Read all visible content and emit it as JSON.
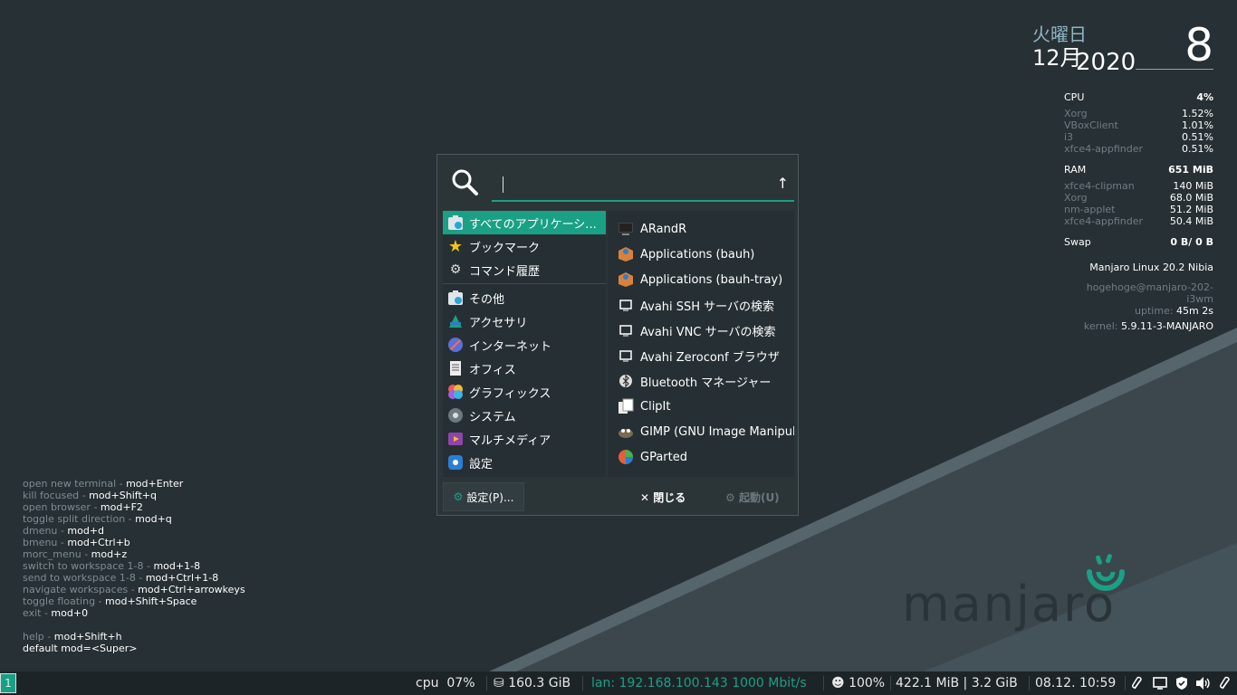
{
  "conky_date": {
    "weekday": "火曜日",
    "month": "12月",
    "year": "2020",
    "day": "8"
  },
  "conky_stats": {
    "cpu": {
      "label": "CPU",
      "value": "4%",
      "procs": [
        {
          "name": "Xorg",
          "value": "1.52%"
        },
        {
          "name": "VBoxClient",
          "value": "1.01%"
        },
        {
          "name": "i3",
          "value": "0.51%"
        },
        {
          "name": "xfce4-appfinder",
          "value": "0.51%"
        }
      ]
    },
    "ram": {
      "label": "RAM",
      "value": "651 MiB",
      "procs": [
        {
          "name": "xfce4-clipman",
          "value": "140 MiB"
        },
        {
          "name": "Xorg",
          "value": "68.0 MiB"
        },
        {
          "name": "nm-applet",
          "value": "51.2 MiB"
        },
        {
          "name": "xfce4-appfinder",
          "value": "50.4 MiB"
        }
      ]
    },
    "swap": {
      "label": "Swap",
      "value": "0 B/ 0 B"
    },
    "os": "Manjaro Linux 20.2 Nibia",
    "host": "hogehoge@manjaro-202-i3wm",
    "uptime_label": "uptime:",
    "uptime_value": "45m 2s",
    "kernel_label": "kernel:",
    "kernel_value": "5.9.11-3-MANJARO"
  },
  "help": [
    {
      "k": "open new terminal - ",
      "v": "mod+Enter"
    },
    {
      "k": "kill focused - ",
      "v": "mod+Shift+q"
    },
    {
      "k": "open browser - ",
      "v": "mod+F2"
    },
    {
      "k": "toggle split direction - ",
      "v": "mod+q"
    },
    {
      "k": "dmenu - ",
      "v": "mod+d"
    },
    {
      "k": "bmenu - ",
      "v": "mod+Ctrl+b"
    },
    {
      "k": "morc_menu - ",
      "v": "mod+z"
    },
    {
      "k": "switch to workspace 1-8 - ",
      "v": "mod+1-8"
    },
    {
      "k": "send to workspace 1-8 - ",
      "v": "mod+Ctrl+1-8"
    },
    {
      "k": "navigate workspaces - ",
      "v": "mod+Ctrl+arrowkeys"
    },
    {
      "k": "toggle floating - ",
      "v": "mod+Shift+Space"
    },
    {
      "k": "exit - ",
      "v": "mod+0"
    },
    {
      "k": "",
      "v": ""
    },
    {
      "k": "help - ",
      "v": "mod+Shift+h"
    },
    {
      "k": "",
      "v": "default mod=<Super>"
    }
  ],
  "logo_text": "manjaro",
  "finder": {
    "search_value": "",
    "categories": [
      {
        "label": "すべてのアプリケーシ...",
        "icon": "all-apps-icon",
        "selected": true
      },
      {
        "label": "ブックマーク",
        "icon": "star-icon"
      },
      {
        "label": "コマンド履歴",
        "icon": "history-icon"
      },
      {
        "label": "その他",
        "icon": "other-icon"
      },
      {
        "label": "アクセサリ",
        "icon": "accessories-icon"
      },
      {
        "label": "インターネット",
        "icon": "internet-icon"
      },
      {
        "label": "オフィス",
        "icon": "office-icon"
      },
      {
        "label": "グラフィックス",
        "icon": "graphics-icon"
      },
      {
        "label": "システム",
        "icon": "system-icon"
      },
      {
        "label": "マルチメディア",
        "icon": "multimedia-icon"
      },
      {
        "label": "設定",
        "icon": "settings-icon"
      }
    ],
    "apps": [
      {
        "label": "ARandR",
        "icon": "monitor-icon"
      },
      {
        "label": "Applications (bauh)",
        "icon": "bauh-icon"
      },
      {
        "label": "Applications (bauh-tray)",
        "icon": "bauh-icon"
      },
      {
        "label": "Avahi SSH サーバの検索",
        "icon": "avahi-icon"
      },
      {
        "label": "Avahi VNC サーバの検索",
        "icon": "avahi-icon"
      },
      {
        "label": "Avahi Zeroconf ブラウザ",
        "icon": "avahi-icon"
      },
      {
        "label": "Bluetooth マネージャー",
        "icon": "bluetooth-icon"
      },
      {
        "label": "ClipIt",
        "icon": "clipboard-icon"
      },
      {
        "label": "GIMP (GNU Image Manipulation Program)",
        "icon": "gimp-icon"
      },
      {
        "label": "GParted",
        "icon": "gparted-icon"
      }
    ],
    "settings_button": "設定(P)...",
    "close_button": "閉じる",
    "launch_button": "起動(U)"
  },
  "bar": {
    "workspace": "1",
    "cpu_label": "cpu",
    "cpu_value": "07%",
    "disk": "160.3 GiB",
    "lan": "lan: 192.168.100.143 1000 Mbit/s",
    "battery": "100%",
    "memory": "422.1 MiB | 3.2 GiB",
    "clock": "08.12. 10:59"
  },
  "colors": {
    "accent": "#1aa085",
    "lan": "#1aa085",
    "background": "#273034"
  }
}
